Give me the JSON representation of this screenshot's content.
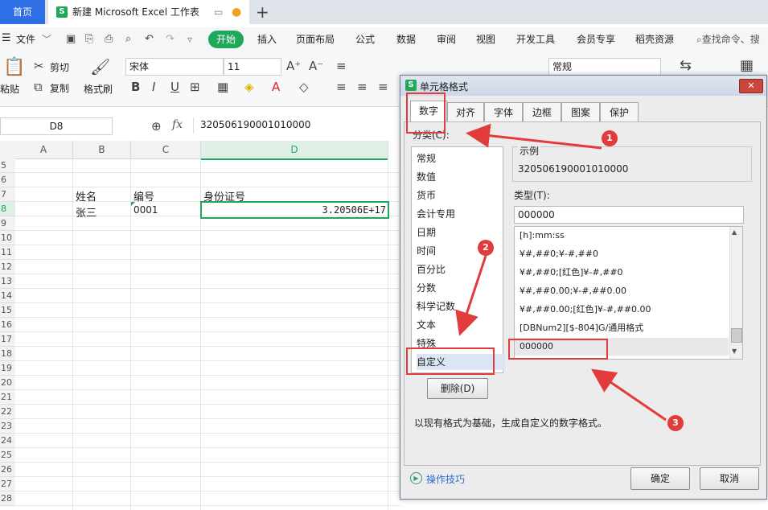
{
  "titlebar": {
    "home_tab": "首页",
    "doc_tab": "新建 Microsoft Excel 工作表",
    "logo": "S",
    "new_tab": "+"
  },
  "menubar": {
    "file_label": "文件",
    "start_label": "开始",
    "items": [
      "插入",
      "页面布局",
      "公式",
      "数据",
      "审阅",
      "视图",
      "开发工具",
      "会员专享",
      "稻壳资源"
    ],
    "search_label": "查找命令、搜"
  },
  "ribbon": {
    "paste": "粘贴",
    "cut": "剪切",
    "copy": "复制",
    "format_painter": "格式刷",
    "font_name": "宋体",
    "font_size": "11",
    "number_format": "常规"
  },
  "formula_bar": {
    "cell_ref": "D8",
    "fx": "fx",
    "content": "320506190001010000"
  },
  "grid": {
    "columns": [
      "A",
      "B",
      "C",
      "D"
    ],
    "rows": [
      "5",
      "6",
      "7",
      "8",
      "9",
      "10",
      "11",
      "12",
      "13",
      "14",
      "15",
      "16",
      "17",
      "18",
      "19",
      "20",
      "21",
      "22",
      "23",
      "24",
      "25",
      "26",
      "27",
      "28"
    ],
    "header_name": "姓名",
    "header_id": "编号",
    "header_idcard": "身份证号",
    "row8_name": "张三",
    "row8_id": "0001",
    "row8_idcard": "3.20506E+17"
  },
  "dialog": {
    "title": "单元格格式",
    "tabs": [
      "数字",
      "对齐",
      "字体",
      "边框",
      "图案",
      "保护"
    ],
    "category_label": "分类(C):",
    "categories": [
      "常规",
      "数值",
      "货币",
      "会计专用",
      "日期",
      "时间",
      "百分比",
      "分数",
      "科学记数",
      "文本",
      "特殊",
      "自定义"
    ],
    "sample_label": "示例",
    "sample_value": "320506190001010000",
    "type_label": "类型(T):",
    "type_value": "000000",
    "formats": [
      "[h]:mm:ss",
      "¥#,##0;¥-#,##0",
      "¥#,##0;[红色]¥-#,##0",
      "¥#,##0.00;¥-#,##0.00",
      "¥#,##0.00;[红色]¥-#,##0.00",
      "[DBNum2][$-804]G/通用格式",
      "000000"
    ],
    "delete_button": "删除(D)",
    "description": "以现有格式为基础，生成自定义的数字格式。",
    "tips_link": "操作技巧",
    "ok_button": "确定",
    "cancel_button": "取消",
    "close_glyph": "✕"
  },
  "annotations": {
    "badges": [
      "1",
      "2",
      "3"
    ],
    "accent_color": "#e23b3b"
  },
  "colors": {
    "brand_green": "#1fa85a",
    "home_blue": "#2f6fe6"
  }
}
